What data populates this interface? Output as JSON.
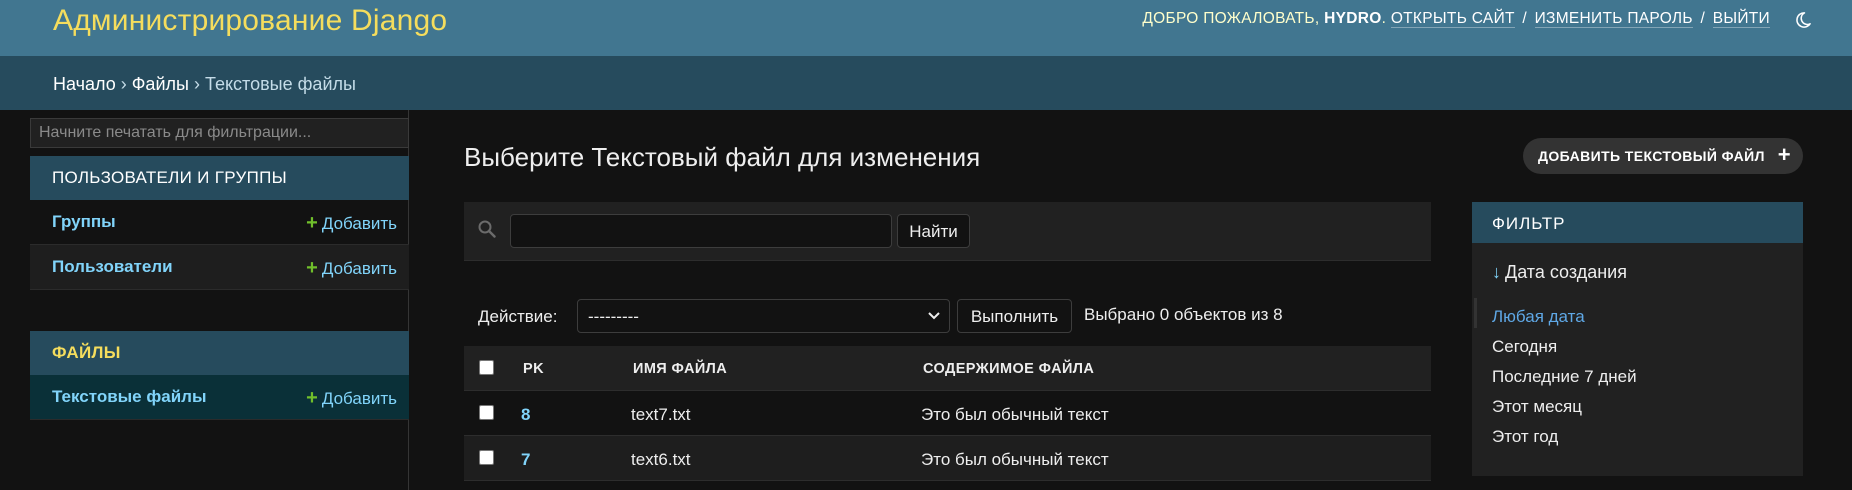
{
  "header": {
    "site_name": "Администрирование Django",
    "welcome": "ДОБРО ПОЖАЛОВАТЬ,",
    "username": "HYDRO",
    "view_site": "ОТКРЫТЬ САЙТ",
    "change_password": "ИЗМЕНИТЬ ПАРОЛЬ",
    "logout": "ВЫЙТИ",
    "separator": "/",
    "theme_icon": "moon-icon"
  },
  "breadcrumbs": {
    "home": "Начало",
    "app": "Файлы",
    "current": "Текстовые файлы",
    "separator": "›"
  },
  "sidebar": {
    "filter_placeholder": "Начните печатать для фильтрации...",
    "apps": [
      {
        "caption": "ПОЛЬЗОВАТЕЛИ И ГРУППЫ",
        "models": [
          {
            "name": "Группы",
            "add": "Добавить"
          },
          {
            "name": "Пользователи",
            "add": "Добавить"
          }
        ]
      },
      {
        "caption": "ФАЙЛЫ",
        "models": [
          {
            "name": "Текстовые файлы",
            "add": "Добавить"
          }
        ]
      }
    ],
    "plus_glyph": "+"
  },
  "content": {
    "title": "Выберите Текстовый файл для изменения",
    "add_button": "ДОБАВИТЬ ТЕКСТОВЫЙ ФАЙЛ",
    "search_value": "",
    "search_button": "Найти",
    "action_label": "Действие:",
    "action_selected": "---------",
    "action_go": "Выполнить",
    "action_counter": "Выбрано 0 объектов из 8"
  },
  "table": {
    "columns": [
      "PK",
      "ИМЯ ФАЙЛА",
      "СОДЕРЖИМОЕ ФАЙЛА"
    ],
    "rows": [
      {
        "pk": "8",
        "filename": "text7.txt",
        "content": "Это был обычный текст"
      },
      {
        "pk": "7",
        "filename": "text6.txt",
        "content": "Это был обычный текст"
      }
    ]
  },
  "filter": {
    "heading": "ФИЛЬТР",
    "sort_arrow": "↓",
    "field": "Дата создания",
    "options": [
      "Любая дата",
      "Сегодня",
      "Последние 7 дней",
      "Этот месяц",
      "Этот год"
    ],
    "selected_index": 0
  },
  "colors": {
    "header_bg": "#417690",
    "site_name": "#f5dd5d",
    "breadcrumbs_bg": "#264b5d",
    "link": "#81d4fa",
    "add_green": "#70bf2b",
    "page_bg": "#121212"
  }
}
